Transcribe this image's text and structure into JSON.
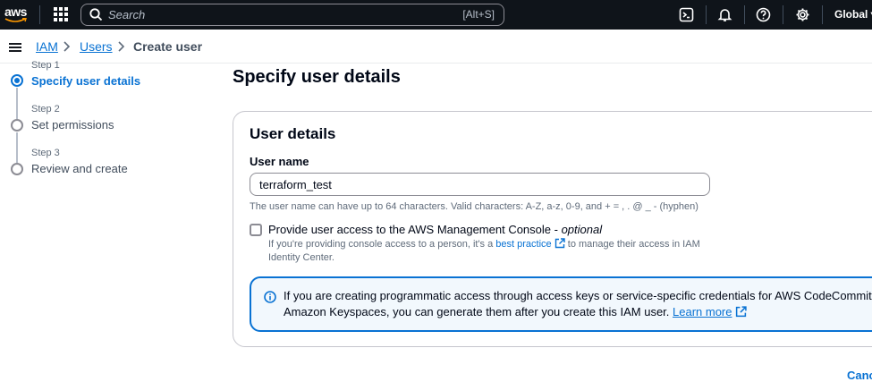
{
  "topnav": {
    "logo_text": "aws",
    "search_placeholder": "Search",
    "search_shortcut": "[Alt+S]",
    "region": "Global"
  },
  "breadcrumb": {
    "items": [
      "IAM",
      "Users"
    ],
    "current": "Create user"
  },
  "steps": [
    {
      "step": "Step 1",
      "title": "Specify user details",
      "active": true
    },
    {
      "step": "Step 2",
      "title": "Set permissions",
      "active": false
    },
    {
      "step": "Step 3",
      "title": "Review and create",
      "active": false
    }
  ],
  "main": {
    "page_title": "Specify user details",
    "section_title": "User details",
    "user_name_label": "User name",
    "user_name_value": "terraform_test",
    "user_name_hint": "The user name can have up to 64 characters. Valid characters: A-Z, a-z, 0-9, and + = , . @ _ - (hyphen)",
    "console_checkbox_label": "Provide user access to the AWS Management Console - ",
    "console_checkbox_optional": "optional",
    "console_desc_before": "If you're providing console access to a person, it's a ",
    "console_desc_link": "best practice",
    "console_desc_after": " to manage their access in IAM Identity Center.",
    "info_text": "If you are creating programmatic access through access keys or service-specific credentials for AWS CodeCommit or Amazon Keyspaces, you can generate them after you create this IAM user. ",
    "info_link": "Learn more",
    "cancel_label": "Cancel"
  },
  "colors": {
    "nav_bg": "#0f141a",
    "link": "#0972d3"
  }
}
